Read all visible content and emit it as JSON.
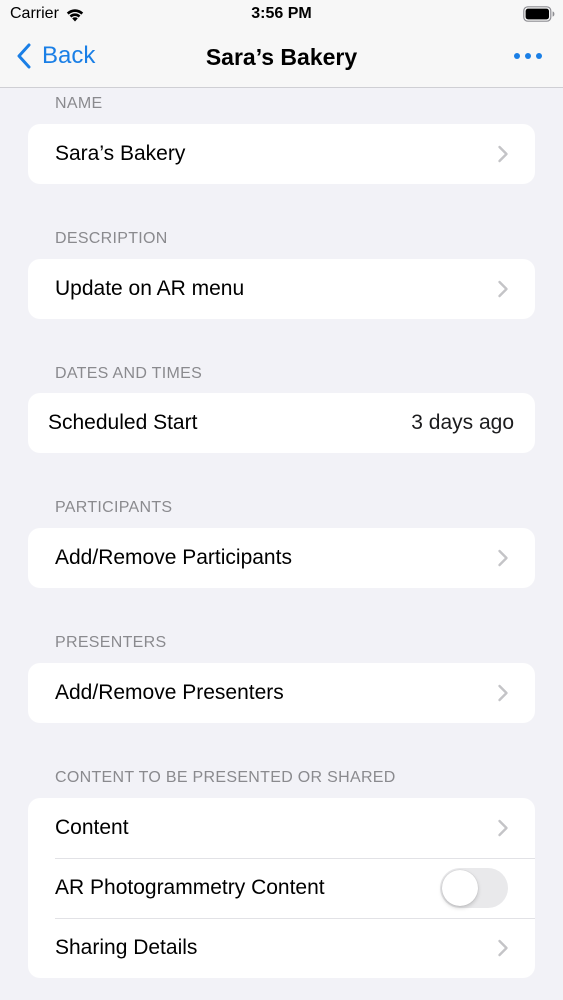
{
  "status_bar": {
    "carrier": "Carrier",
    "time": "3:56 PM"
  },
  "nav": {
    "back_label": "Back",
    "title": "Sara’s Bakery",
    "accent_color": "#1a7fe6"
  },
  "sections": {
    "name": {
      "header": "NAME",
      "value": "Sara’s Bakery"
    },
    "description": {
      "header": "DESCRIPTION",
      "value": "Update on AR menu"
    },
    "dates": {
      "header": "DATES AND TIMES",
      "label": "Scheduled Start",
      "value": "3 days ago"
    },
    "participants": {
      "header": "PARTICIPANTS",
      "label": "Add/Remove Participants"
    },
    "presenters": {
      "header": "PRESENTERS",
      "label": "Add/Remove Presenters"
    },
    "content": {
      "header": "CONTENT TO BE PRESENTED OR SHARED",
      "rows": [
        {
          "label": "Content"
        },
        {
          "label": "AR Photogrammetry Content",
          "toggle_on": false
        },
        {
          "label": "Sharing Details"
        }
      ]
    }
  },
  "icons": {
    "wifi": "wifi-icon",
    "battery": "battery-icon",
    "back": "chevron-left-icon",
    "more": "ellipsis-icon",
    "disclosure": "chevron-right-icon"
  }
}
